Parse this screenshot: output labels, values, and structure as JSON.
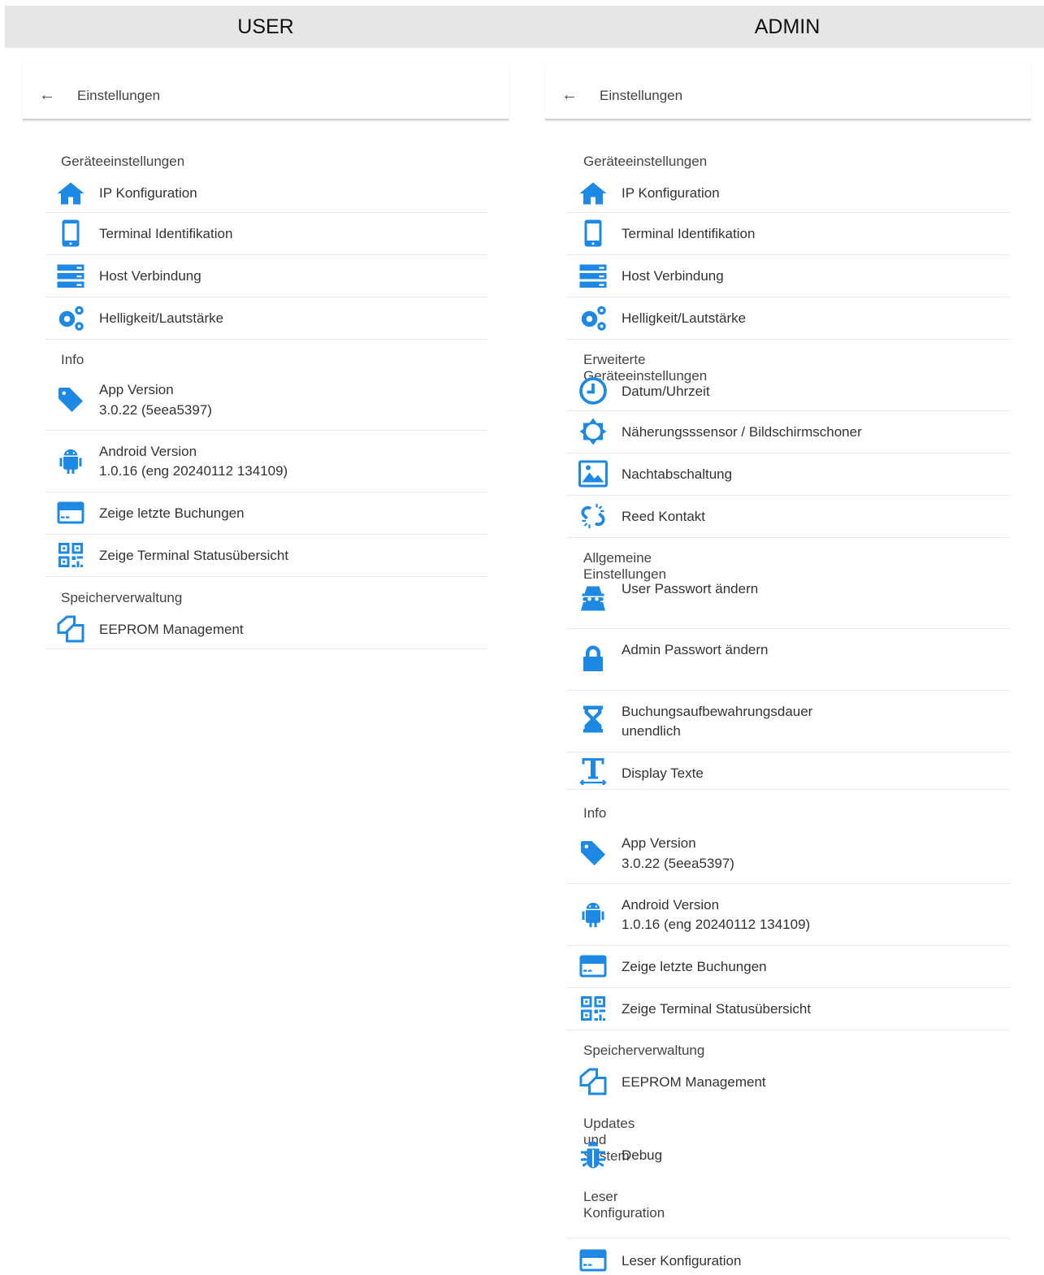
{
  "columns": {
    "user_title": "USER",
    "admin_title": "ADMIN"
  },
  "appbar": {
    "title": "Einstellungen",
    "back_icon": "arrow-left-icon"
  },
  "accent_color": "#1e88e5",
  "user": {
    "sections": {
      "geraet": "Geräteeinstellungen",
      "info": "Info",
      "speicher": "Speicherverwaltung"
    },
    "items": {
      "ip": "IP Konfiguration",
      "terminal": "Terminal Identifikation",
      "host": "Host Verbindung",
      "helligkeit": "Helligkeit/Lautstärke",
      "app_version": "App Version",
      "app_version_value": "3.0.22 (5eea5397)",
      "android_version": "Android Version",
      "android_version_value": "1.0.16 (eng 20240112 134109)",
      "buchungen": "Zeige letzte Buchungen",
      "status": "Zeige Terminal Statusübersicht",
      "eeprom": "EEPROM Management"
    }
  },
  "admin": {
    "sections": {
      "geraet": "Geräteeinstellungen",
      "erweitert": "Erweiterte Geräteeinstellungen",
      "allgemein": "Allgemeine Einstellungen",
      "info": "Info",
      "speicher": "Speicherverwaltung",
      "updates": "Updates und System",
      "leser": "Leser Konfiguration"
    },
    "items": {
      "ip": "IP Konfiguration",
      "terminal": "Terminal Identifikation",
      "host": "Host Verbindung",
      "helligkeit": "Helligkeit/Lautstärke",
      "datum": "Datum/Uhrzeit",
      "sensor": "Näherungsssensor / Bildschirmschoner",
      "nacht": "Nachtabschaltung",
      "reed": "Reed Kontakt",
      "user_pw": "User Passwort ändern",
      "admin_pw": "Admin Passwort ändern",
      "aufbewahrung": "Buchungsaufbewahrungsdauer",
      "aufbewahrung_value": "unendlich",
      "display": "Display Texte",
      "app_version": "App Version",
      "app_version_value": "3.0.22 (5eea5397)",
      "android_version": "Android Version",
      "android_version_value": "1.0.16 (eng 20240112 134109)",
      "buchungen": "Zeige letzte Buchungen",
      "status": "Zeige Terminal Statusübersicht",
      "eeprom": "EEPROM Management",
      "debug": "Debug",
      "leser": "Leser Konfiguration"
    }
  }
}
